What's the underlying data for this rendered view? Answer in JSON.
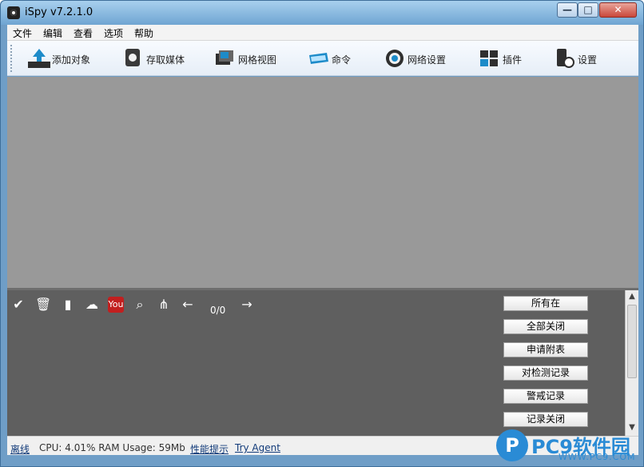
{
  "window": {
    "title": "iSpy v7.2.1.0",
    "buttons": {
      "minimize": "—",
      "maximize": "□",
      "close": "✕"
    }
  },
  "menu": [
    {
      "label": "文件"
    },
    {
      "label": "编辑"
    },
    {
      "label": "查看"
    },
    {
      "label": "选项"
    },
    {
      "label": "帮助"
    }
  ],
  "toolbar": [
    {
      "label": "添加对象",
      "icon": "add-object-icon"
    },
    {
      "label": "存取媒体",
      "icon": "media-icon"
    },
    {
      "label": "网格视图",
      "icon": "grid-view-icon"
    },
    {
      "label": "命令",
      "icon": "command-icon"
    },
    {
      "label": "网络设置",
      "icon": "network-settings-icon"
    },
    {
      "label": "插件",
      "icon": "plugin-icon"
    },
    {
      "label": "设置",
      "icon": "settings-icon"
    }
  ],
  "bottom": {
    "icons": [
      "check-icon",
      "trash-icon",
      "book-icon",
      "cloud-upload-icon",
      "youtube-icon",
      "search-icon",
      "tree-icon",
      "arrow-left-icon",
      "arrow-right-icon"
    ],
    "counter": "0/0",
    "actions": [
      {
        "label": "所有在"
      },
      {
        "label": "全部关闭"
      },
      {
        "label": "申请附表"
      },
      {
        "label": "对检测记录"
      },
      {
        "label": "警戒记录"
      },
      {
        "label": "记录关闭"
      }
    ]
  },
  "status": {
    "offline": "离线",
    "cpu": "CPU: 4.01% RAM Usage: 59Mb",
    "perf_tips": "性能提示",
    "try_agent": "Try Agent"
  },
  "watermark": {
    "text": "PC9软件园",
    "sub": "WWW.PC9.COM"
  }
}
